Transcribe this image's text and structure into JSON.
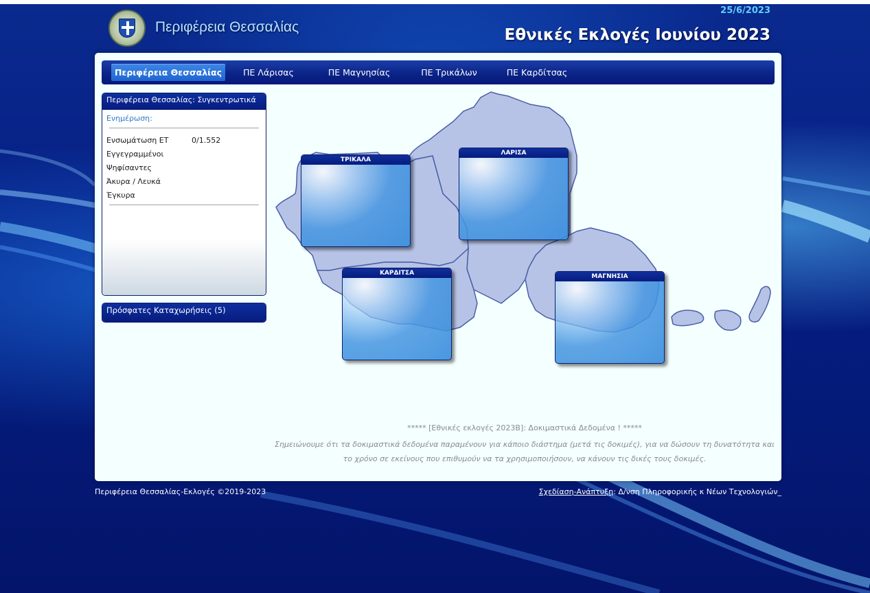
{
  "header": {
    "org_name": "Περιφέρεια Θεσσαλίας",
    "date": "25/6/2023",
    "headline": "Εθνικές Εκλογές Ιουνίου 2023",
    "logo_icon": "greek-coat-of-arms-icon"
  },
  "nav": {
    "items": [
      {
        "label": "Περιφέρεια Θεσσαλίας",
        "active": true
      },
      {
        "label": "ΠΕ Λάρισας",
        "active": false
      },
      {
        "label": "ΠΕ Μαγνησίας",
        "active": false
      },
      {
        "label": "ΠΕ Τρικάλων",
        "active": false
      },
      {
        "label": "ΠΕ Καρδίτσας",
        "active": false
      }
    ]
  },
  "summary": {
    "title": "Περιφέρεια Θεσσαλίας: Συγκεντρωτικά",
    "update_label": "Ενημέρωση:",
    "rows": [
      {
        "label": "Ενσωμάτωση ΕΤ",
        "value": "0/1.552"
      },
      {
        "label": "Εγγεγραμμένοι",
        "value": ""
      },
      {
        "label": "Ψηφίσαντες",
        "value": ""
      },
      {
        "label": "Άκυρα / Λευκά",
        "value": ""
      },
      {
        "label": "Έγκυρα",
        "value": ""
      }
    ]
  },
  "recent": {
    "title": "Πρόσφατες Καταχωρήσεις (5)"
  },
  "districts": {
    "trikala": "ΤΡΙΚΑΛΑ",
    "larisa": "ΛΑΡΙΣΑ",
    "karditsa": "ΚΑΡΔΙΤΣΑ",
    "magnisia": "ΜΑΓΝΗΣΙΑ"
  },
  "notice": {
    "title": "***** [Εθνικές εκλογές 2023Β]: Δοκιμαστικά Δεδομένα ! *****",
    "body": "Σημειώνουμε ότι τα δοκιμαστικά δεδομένα παραμένουν για κάποιο διάστημα (μετά τις δοκιμές), για να δώσουν τη δυνατότητα και το χρόνο σε εκείνους που επιθυμούν να τα χρησιμοποιήσουν, να κάνουν τις δικές τους δοκιμές."
  },
  "footer": {
    "copyright": "Περιφέρεια Θεσσαλίας-Εκλογές ©2019-2023",
    "credit_link": "Σχεδίαση-Ανάπτυξη",
    "credit_text": ": Δ/νση Πληροφορικής κ Νέων Τεχνολογιών_"
  },
  "colors": {
    "page_bg": "#03166a",
    "panel_bg": "#f4ffff",
    "nav_bg": "#0b2488",
    "nav_active": "#2a74dc",
    "map_fill": "#b7c3e6",
    "map_stroke": "#4a5fa8",
    "accent_text": "#2d79c8"
  }
}
